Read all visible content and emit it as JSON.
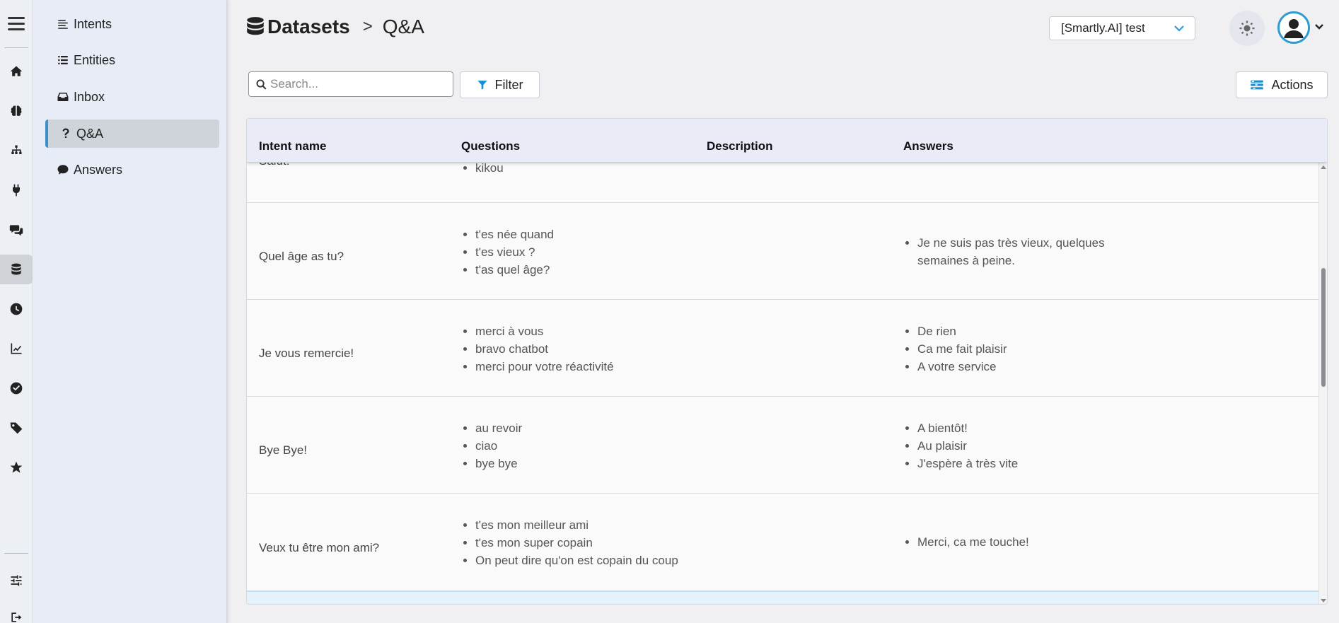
{
  "breadcrumb": {
    "root": "Datasets",
    "separator": ">",
    "current": "Q&A"
  },
  "project_select": {
    "value": "[Smartly.AI] test"
  },
  "sidebar": {
    "items": [
      {
        "label": "Intents",
        "icon": "align-left-icon"
      },
      {
        "label": "Entities",
        "icon": "list-icon"
      },
      {
        "label": "Inbox",
        "icon": "inbox-icon"
      },
      {
        "label": "Q&A",
        "icon": "question-icon",
        "active": true
      },
      {
        "label": "Answers",
        "icon": "comment-icon"
      }
    ]
  },
  "rail": {
    "icons": [
      "menu-icon",
      "home-icon",
      "brain-icon",
      "sitemap-icon",
      "plug-icon",
      "comments-icon",
      "database-icon",
      "clock-icon",
      "chart-line-icon",
      "check-circle-icon",
      "tag-icon",
      "star-icon",
      "sliders-icon",
      "sign-out-icon"
    ]
  },
  "toolbar": {
    "search_placeholder": "Search...",
    "filter_label": "Filter",
    "actions_label": "Actions"
  },
  "table": {
    "columns": [
      "Intent name",
      "Questions",
      "Description",
      "Answers"
    ],
    "partial_row": {
      "intent": "Salut!",
      "questions": [
        "kikou"
      ]
    },
    "rows": [
      {
        "intent": "Quel âge as tu?",
        "questions": [
          "t'es née quand",
          "t'es vieux ?",
          "t'as quel âge?"
        ],
        "description": "",
        "answers": [
          "Je ne suis pas très vieux, quelques semaines à peine."
        ]
      },
      {
        "intent": "Je vous remercie!",
        "questions": [
          "merci à vous",
          "bravo chatbot",
          "merci pour votre réactivité"
        ],
        "description": "",
        "answers": [
          "De rien",
          "Ca me fait plaisir",
          "A votre service"
        ]
      },
      {
        "intent": "Bye Bye!",
        "questions": [
          "au revoir",
          "ciao",
          "bye bye"
        ],
        "description": "",
        "answers": [
          "A bientôt!",
          "Au plaisir",
          "J'espère à très vite"
        ]
      },
      {
        "intent": "Veux tu être mon ami?",
        "questions": [
          "t'es mon meilleur ami",
          "t'es mon super copain",
          "On peut dire qu'on est copain du coup"
        ],
        "description": "",
        "answers": [
          "Merci, ca me touche!"
        ]
      }
    ]
  },
  "colors": {
    "accent": "#2f9bd3",
    "sidebar_bg": "#e8ecf6",
    "header_bg": "#e9ecf7",
    "selected_row": "#e3f2fb"
  }
}
